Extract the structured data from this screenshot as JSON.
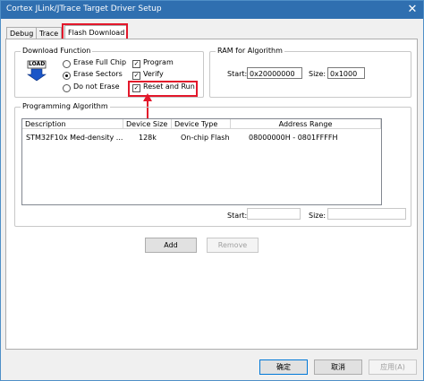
{
  "window": {
    "title": "Cortex JLink/JTrace Target Driver Setup",
    "close_glyph": "✕"
  },
  "tabs": [
    {
      "label": "Debug"
    },
    {
      "label": "Trace"
    },
    {
      "label": "Flash Download"
    }
  ],
  "download_function": {
    "legend": "Download Function",
    "load_icon_text": "LOAD",
    "radios": [
      {
        "label": "Erase Full Chip",
        "selected": false
      },
      {
        "label": "Erase Sectors",
        "selected": true
      },
      {
        "label": "Do not Erase",
        "selected": false
      }
    ],
    "checks": [
      {
        "label": "Program",
        "checked": true
      },
      {
        "label": "Verify",
        "checked": true
      },
      {
        "label": "Reset and Run",
        "checked": true
      }
    ],
    "check_glyph": "✓"
  },
  "ram": {
    "legend": "RAM for Algorithm",
    "start_label": "Start:",
    "start_value": "0x20000000",
    "size_label": "Size:",
    "size_value": "0x1000"
  },
  "programming": {
    "legend": "Programming Algorithm",
    "columns": [
      "Description",
      "Device Size",
      "Device Type",
      "Address Range"
    ],
    "rows": [
      {
        "description": "STM32F10x Med-density ...",
        "size": "128k",
        "type": "On-chip Flash",
        "range": "08000000H - 0801FFFFH"
      }
    ],
    "start_label": "Start:",
    "size_label": "Size:"
  },
  "buttons": {
    "add": "Add",
    "remove": "Remove",
    "ok": "确定",
    "cancel": "取消",
    "apply": "应用(A)"
  },
  "colors": {
    "annotation": "#e3182b",
    "titlebar": "#2f6fb0"
  }
}
